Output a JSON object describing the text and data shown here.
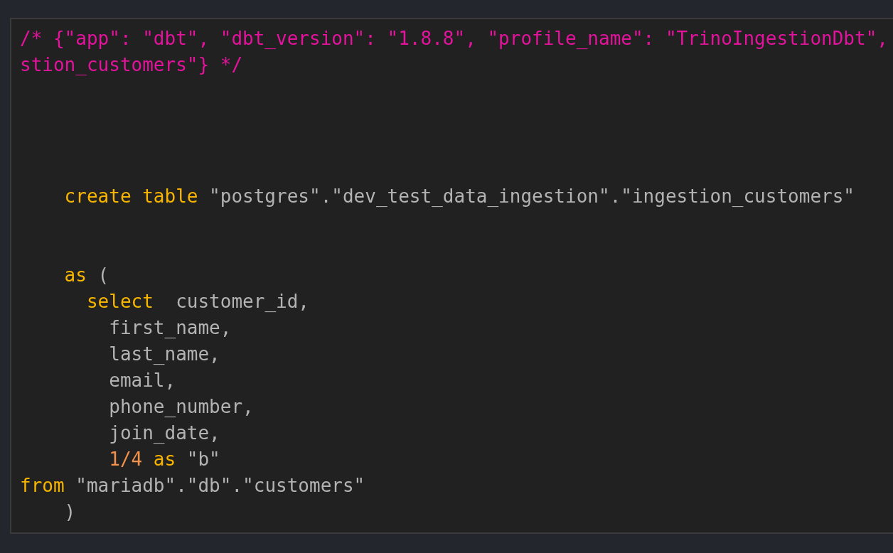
{
  "code_block": {
    "lines": [
      {
        "kind": "code",
        "segments": [
          {
            "kind": "comment",
            "text": "/* {\"app\": \"dbt\", \"dbt_version\": \"1.8.8\", \"profile_name\": \"TrinoIngestionDbt\","
          }
        ]
      },
      {
        "kind": "code",
        "segments": [
          {
            "kind": "comment",
            "text": "stion_customers\"} */"
          }
        ]
      },
      {
        "kind": "blank"
      },
      {
        "kind": "blank"
      },
      {
        "kind": "blank"
      },
      {
        "kind": "blank"
      },
      {
        "kind": "code",
        "segments": [
          {
            "kind": "keyword",
            "text": "    create table"
          },
          {
            "kind": "plain",
            "text": " \"postgres\".\"dev_test_data_ingestion\".\"ingestion_customers\""
          }
        ]
      },
      {
        "kind": "blank"
      },
      {
        "kind": "blank"
      },
      {
        "kind": "code",
        "segments": [
          {
            "kind": "keyword",
            "text": "    as"
          },
          {
            "kind": "plain",
            "text": " ("
          }
        ]
      },
      {
        "kind": "code",
        "segments": [
          {
            "kind": "keyword",
            "text": "      select"
          },
          {
            "kind": "plain",
            "text": "  customer_id,"
          }
        ]
      },
      {
        "kind": "code",
        "segments": [
          {
            "kind": "plain",
            "text": "        first_name,"
          }
        ]
      },
      {
        "kind": "code",
        "segments": [
          {
            "kind": "plain",
            "text": "        last_name,"
          }
        ]
      },
      {
        "kind": "code",
        "segments": [
          {
            "kind": "plain",
            "text": "        email,"
          }
        ]
      },
      {
        "kind": "code",
        "segments": [
          {
            "kind": "plain",
            "text": "        phone_number,"
          }
        ]
      },
      {
        "kind": "code",
        "segments": [
          {
            "kind": "plain",
            "text": "        join_date,"
          }
        ]
      },
      {
        "kind": "code",
        "segments": [
          {
            "kind": "number",
            "text": "        1/4"
          },
          {
            "kind": "keyword",
            "text": " as"
          },
          {
            "kind": "plain",
            "text": " \"b\""
          }
        ]
      },
      {
        "kind": "code",
        "segments": [
          {
            "kind": "keyword",
            "text": "from"
          },
          {
            "kind": "plain",
            "text": " \"mariadb\".\"db\".\"customers\""
          }
        ]
      },
      {
        "kind": "code",
        "segments": [
          {
            "kind": "plain",
            "text": "    )"
          }
        ]
      }
    ]
  }
}
